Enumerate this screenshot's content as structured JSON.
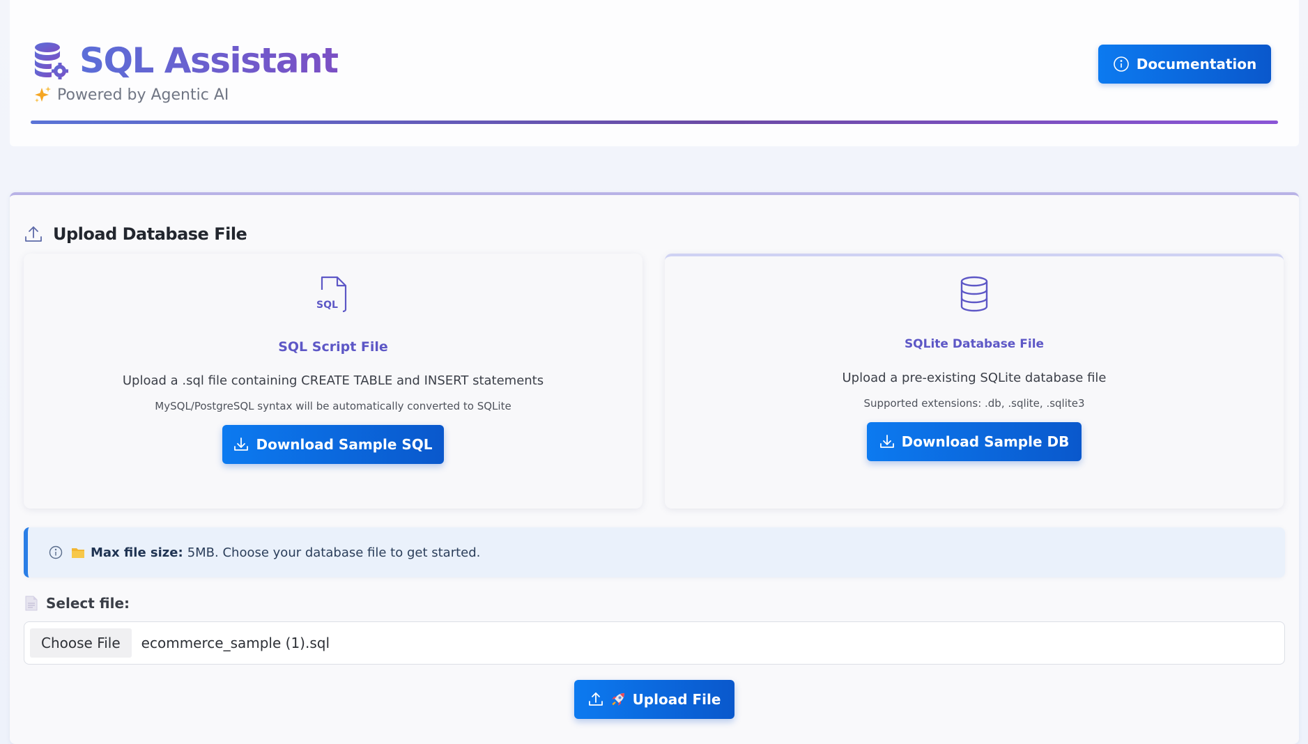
{
  "header": {
    "title": "SQL Assistant",
    "subtitle": "Powered by Agentic AI",
    "documentation_label": "Documentation"
  },
  "upload": {
    "section_title": "Upload Database File",
    "sql_option": {
      "title": "SQL Script File",
      "description": "Upload a .sql file containing CREATE TABLE and INSERT statements",
      "note": "MySQL/PostgreSQL syntax will be automatically converted to SQLite",
      "button_label": "Download Sample SQL",
      "icon_text": "SQL"
    },
    "sqlite_option": {
      "title": "SQLite Database File",
      "description": "Upload a pre-existing SQLite database file",
      "note": "Supported extensions: .db, .sqlite, .sqlite3",
      "button_label": "Download Sample DB"
    },
    "info": {
      "label": "Max file size:",
      "text": "5MB. Choose your database file to get started."
    },
    "select_label": "Select file:",
    "choose_file_label": "Choose File",
    "selected_file": "ecommerce_sample (1).sql",
    "upload_button_label": "Upload File"
  },
  "colors": {
    "primary": "#0a6be0",
    "brand_gradient_start": "#5b6ed8",
    "brand_gradient_end": "#7b4fc4",
    "option_title": "#5d57c6",
    "info_accent": "#2a7ee6"
  }
}
